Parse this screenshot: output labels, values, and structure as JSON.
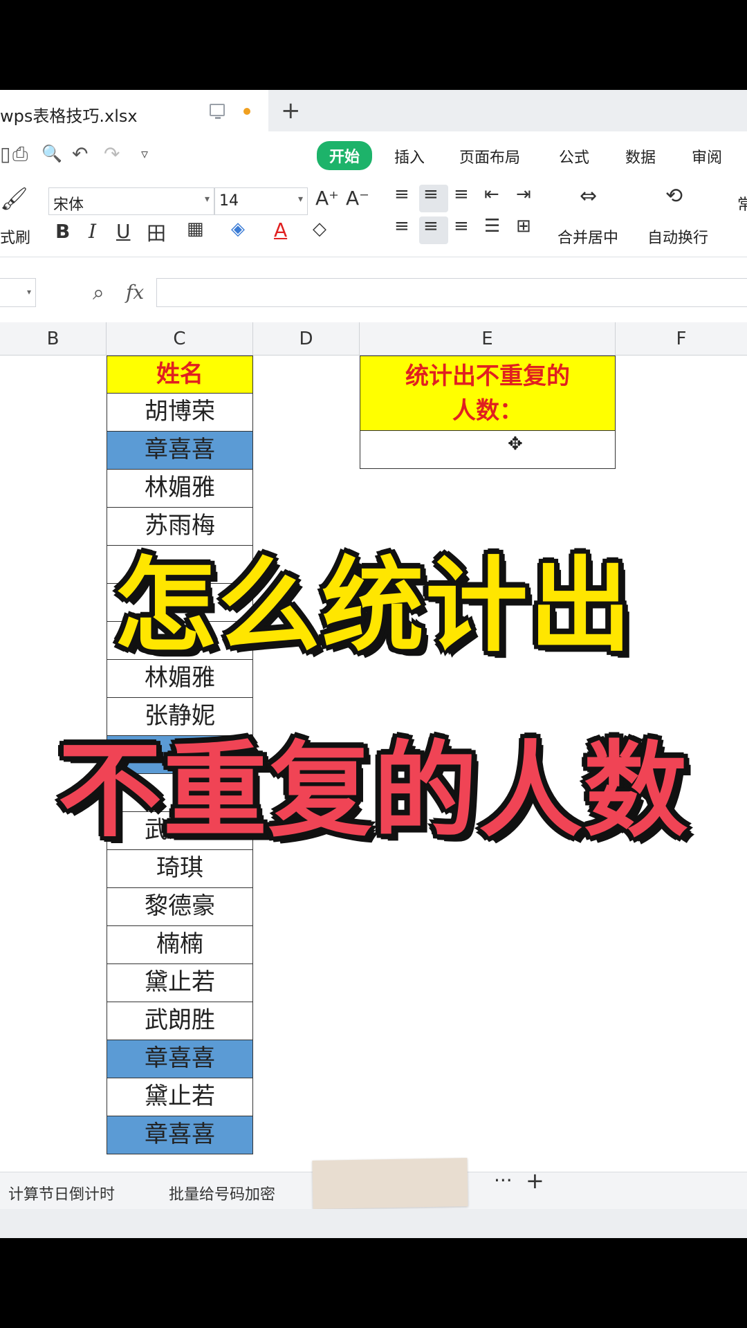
{
  "window": {
    "doc_title": "wps表格技巧.xlsx",
    "new_tab": "+"
  },
  "menu": {
    "quick_icons": [
      "save-icon",
      "print-icon",
      "print-preview-icon",
      "undo-icon",
      "redo-icon",
      "more-icon"
    ],
    "quick_glyphs": [
      "▯",
      "⎙",
      "🔍",
      "↶",
      "↷",
      "▿"
    ],
    "items": [
      "开始",
      "插入",
      "页面布局",
      "公式",
      "数据",
      "审阅"
    ]
  },
  "ribbon": {
    "format_painter_label": "式刷",
    "font_name": "宋体",
    "font_size": "14",
    "grow_font": "A⁺",
    "shrink_font": "A⁻",
    "bold": "B",
    "italic": "I",
    "underline": "U",
    "border": "田",
    "fill_letter": "A",
    "merge_label": "合并居中",
    "wrap_label": "自动换行",
    "style_label": "常"
  },
  "formula_bar": {
    "fx": "fx",
    "value": ""
  },
  "columns": [
    "B",
    "C",
    "D",
    "E",
    "F"
  ],
  "name_column": {
    "header": "姓名",
    "rows": [
      {
        "name": "胡博荣",
        "highlight": false
      },
      {
        "name": "章喜喜",
        "highlight": true
      },
      {
        "name": "林媚雅",
        "highlight": false
      },
      {
        "name": "苏雨梅",
        "highlight": false
      },
      {
        "name": "",
        "highlight": false
      },
      {
        "name": "",
        "highlight": false
      },
      {
        "name": "",
        "highlight": false
      },
      {
        "name": "林媚雅",
        "highlight": false
      },
      {
        "name": "张静妮",
        "highlight": false
      },
      {
        "name": "",
        "highlight": true
      },
      {
        "name": "",
        "highlight": false
      },
      {
        "name": "武朗胜",
        "highlight": false
      },
      {
        "name": "琦琪",
        "highlight": false
      },
      {
        "name": "黎德豪",
        "highlight": false
      },
      {
        "name": "楠楠",
        "highlight": false
      },
      {
        "name": "黛止若",
        "highlight": false
      },
      {
        "name": "武朗胜",
        "highlight": false
      },
      {
        "name": "章喜喜",
        "highlight": true
      },
      {
        "name": "黛止若",
        "highlight": false
      },
      {
        "name": "章喜喜",
        "highlight": true
      }
    ]
  },
  "task_box": {
    "title_line1": "统计出不重复的",
    "title_line2": "人数：",
    "answer": ""
  },
  "captions": {
    "line1": "怎么统计出",
    "line2": "不重复的人数"
  },
  "sheet_tabs": [
    "计算节日倒计时",
    "批量给号码加密"
  ],
  "tab_controls": {
    "more": "···",
    "add": "+"
  },
  "colors": {
    "accent": "#1db36a",
    "header_fill": "#ffff00",
    "header_text": "#e02020",
    "highlight_fill": "#5b9bd5",
    "caption1": "#ffe600",
    "caption2": "#f04455"
  }
}
